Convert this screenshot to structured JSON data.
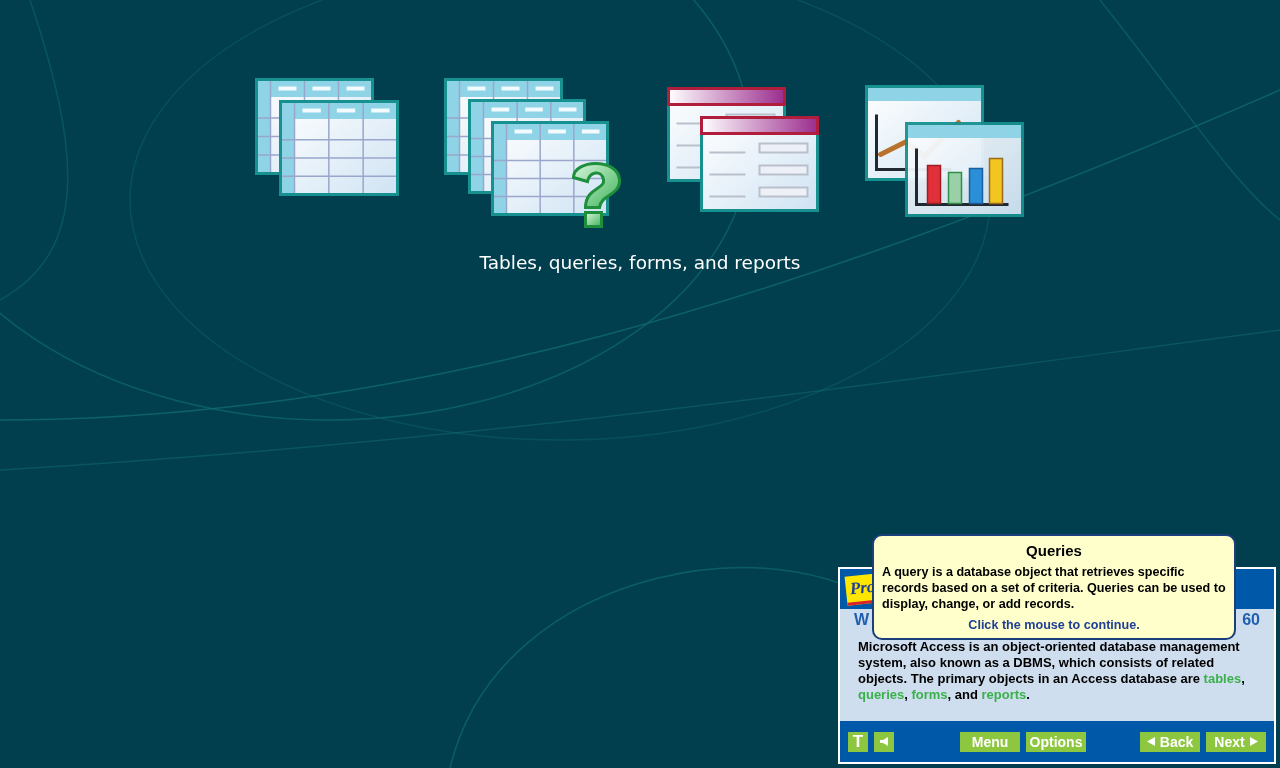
{
  "caption": "Tables, queries, forms, and reports",
  "panel": {
    "logo": "Pro",
    "heading_start": "W",
    "heading_end": "60",
    "body": [
      {
        "kind": "plain",
        "text": "Microsoft Access is an object-oriented database management system, also known as a DBMS, which consists of related objects. The primary objects in an Access database are "
      },
      {
        "kind": "term",
        "text": "tables"
      },
      {
        "kind": "plain",
        "text": ", "
      },
      {
        "kind": "term",
        "text": "queries"
      },
      {
        "kind": "plain",
        "text": ", "
      },
      {
        "kind": "term",
        "text": "forms"
      },
      {
        "kind": "plain",
        "text": ", and "
      },
      {
        "kind": "term",
        "text": "reports"
      },
      {
        "kind": "plain",
        "text": "."
      }
    ],
    "toolbar": {
      "text_button": "T",
      "menu": "Menu",
      "options": "Options",
      "back": "Back",
      "next": "Next"
    }
  },
  "popup": {
    "title": "Queries",
    "text": "A query is a database object that retrieves specific records based on a set of criteria. Queries can be used to display, change, or add records.",
    "hint": "Click the mouse to continue."
  }
}
